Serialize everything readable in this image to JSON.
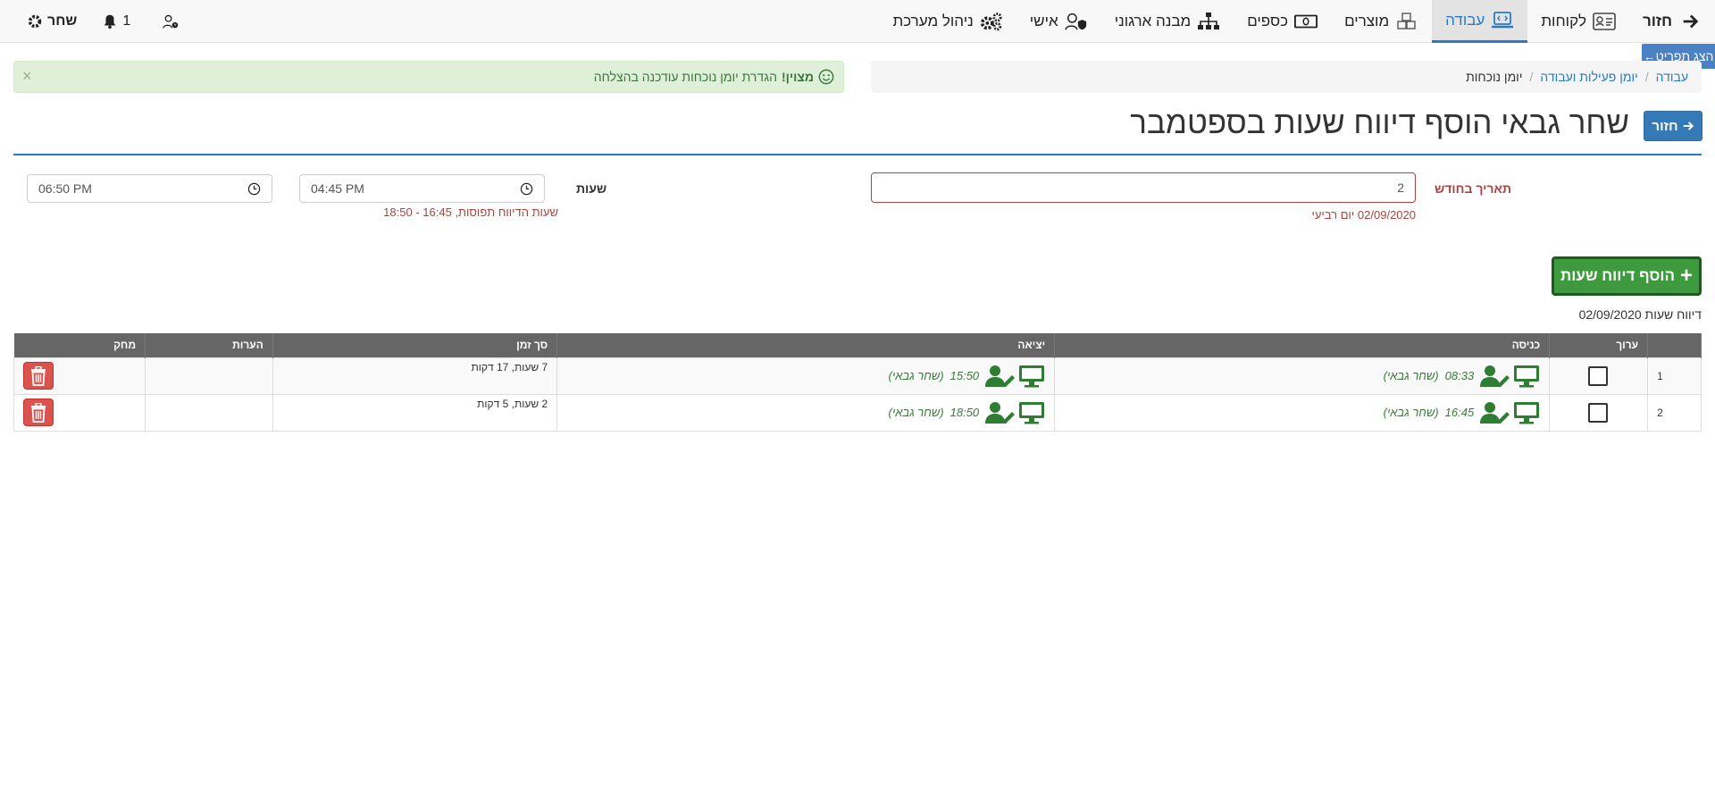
{
  "nav": {
    "back": "חזור",
    "items": [
      {
        "label": "לקוחות",
        "icon": "id-card-icon"
      },
      {
        "label": "עבודה",
        "icon": "laptop-code-icon",
        "active": true
      },
      {
        "label": "מוצרים",
        "icon": "boxes-icon"
      },
      {
        "label": "כספים",
        "icon": "money-bill-icon"
      },
      {
        "label": "מבנה ארגוני",
        "icon": "sitemap-icon"
      },
      {
        "label": "אישי",
        "icon": "user-shield-icon"
      },
      {
        "label": "ניהול מערכת",
        "icon": "cogs-icon"
      }
    ],
    "user_name": "שחר",
    "notifications_count": "1"
  },
  "print_tab": "הצג תפריט←",
  "breadcrumb": {
    "items": [
      "עבודה",
      "יומן פעילות ועבודה"
    ],
    "current": "יומן נוכחות"
  },
  "alert": {
    "strong": "מצוין!",
    "text": "הגדרת יומן נוכחות עודכנה בהצלחה",
    "close": "×"
  },
  "header": {
    "back_button": "חזור",
    "title": "שחר גבאי הוסף דיווח שעות בספטמבר"
  },
  "form": {
    "date_label": "תאריך בחודש",
    "date_value": "2",
    "date_hint": "02/09/2020 יום רביעי",
    "hours_label": "שעות",
    "time_from": "04:45 PM",
    "time_to": "06:50 PM",
    "time_hint": "שעות הדיווח תפוסות, 16:45 - 18:50"
  },
  "add_button": "הוסף דיווח שעות",
  "report_date": "דיווח שעות 02/09/2020",
  "table": {
    "headers": {
      "edit": "ערוך",
      "in": "כניסה",
      "out": "יציאה",
      "total": "סך זמן",
      "notes": "הערות",
      "delete": "מחק"
    },
    "rows": [
      {
        "num": "1",
        "in_time": "08:33",
        "in_user": "(שחר גבאי)",
        "out_time": "15:50",
        "out_user": "(שחר גבאי)",
        "total": "7 שעות, 17 דקות",
        "notes": ""
      },
      {
        "num": "2",
        "in_time": "16:45",
        "in_user": "(שחר גבאי)",
        "out_time": "18:50",
        "out_user": "(שחר גבאי)",
        "total": "2 שעות, 5 דקות",
        "notes": ""
      }
    ]
  },
  "colors": {
    "primary": "#337ab7",
    "success": "#3d9a3d",
    "danger": "#d9534f",
    "punch_green": "#2e7d32"
  }
}
